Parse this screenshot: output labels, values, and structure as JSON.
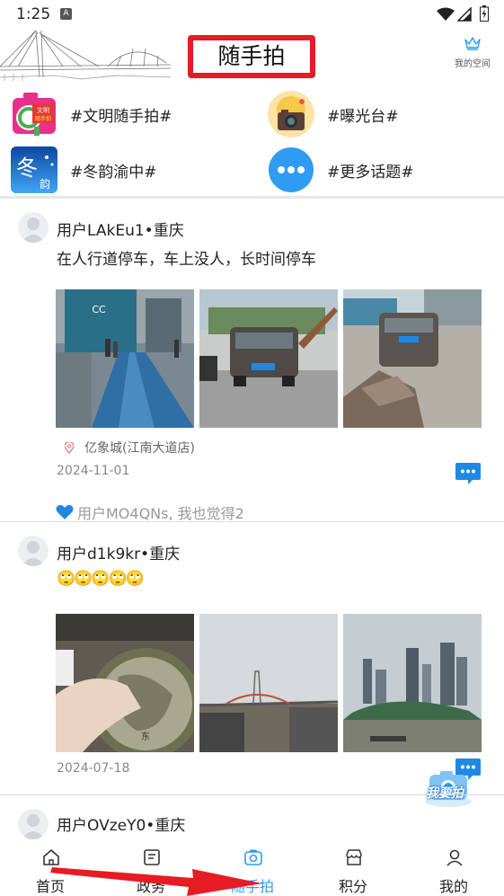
{
  "status_bar": {
    "time": "1:25",
    "badge": "A"
  },
  "header": {
    "title": "随手拍",
    "my_space_label": "我的空间"
  },
  "topics": [
    {
      "label": "#文明随手拍#",
      "icon": "wenming-topic-icon"
    },
    {
      "label": "#曝光台#",
      "icon": "camera-topic-icon"
    },
    {
      "label": "#冬韵渝中#",
      "icon": "winter-topic-icon"
    },
    {
      "label": "#更多话题#",
      "icon": "more-topics-icon"
    }
  ],
  "posts": [
    {
      "user": "用户LAkEu1•重庆",
      "text": "在人行道停车，车上没人，长时间停车",
      "location": "亿象城(江南大道店)",
      "date": "2024-11-01",
      "like_text": "用户MO4QNs, 我也觉得2"
    },
    {
      "user": "用户d1k9kr•重庆",
      "text": "🙄🙄🙄🙄🙄",
      "date": "2024-07-18"
    },
    {
      "user": "用户OVzeY0•重庆"
    }
  ],
  "float_button_label": "我要拍",
  "tabbar": {
    "tabs": [
      {
        "label": "首页",
        "icon": "home-icon"
      },
      {
        "label": "政务",
        "icon": "document-icon"
      },
      {
        "label": "随手拍",
        "icon": "camera-icon"
      },
      {
        "label": "积分",
        "icon": "store-icon"
      },
      {
        "label": "我的",
        "icon": "user-icon"
      }
    ],
    "active_index": 2
  },
  "colors": {
    "accent": "#2f9bf2",
    "annotation_red": "#e51c23",
    "comment_blue": "#1e88e5"
  }
}
